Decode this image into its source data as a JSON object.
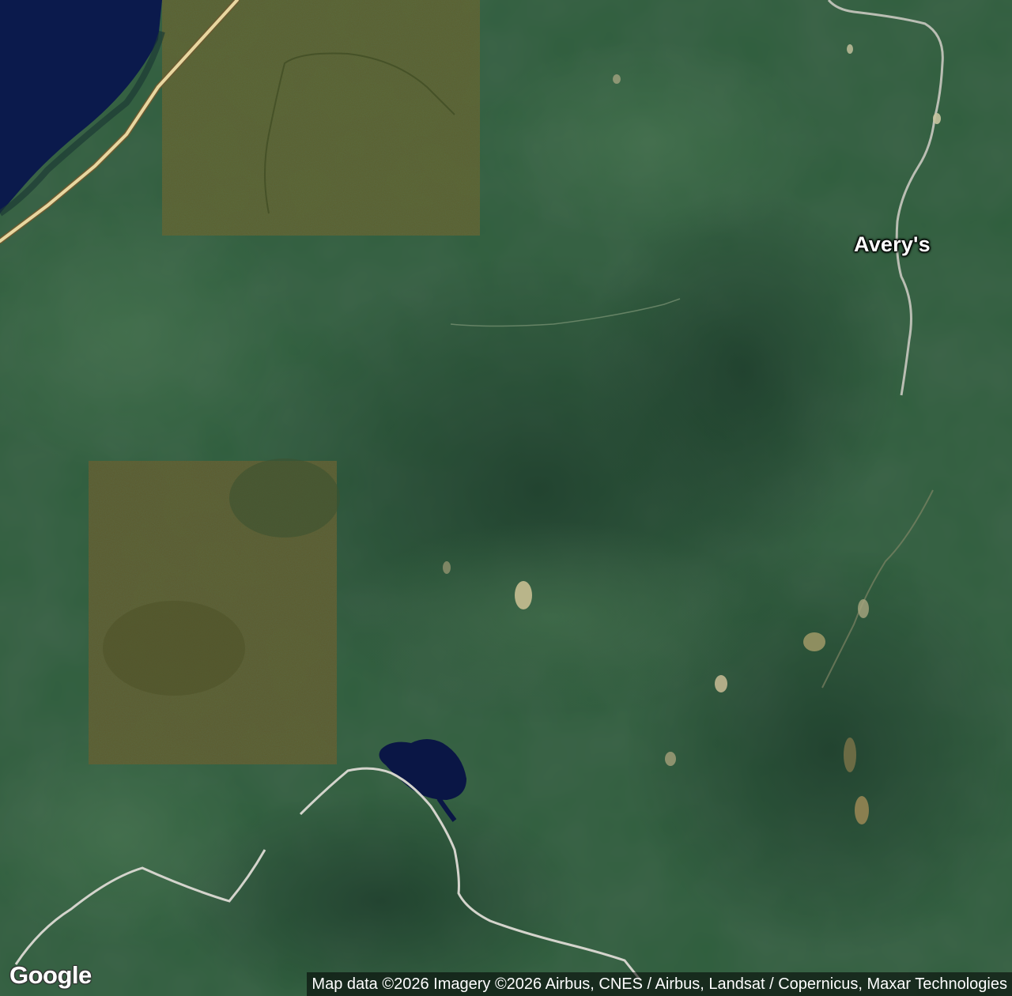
{
  "map": {
    "type": "satellite",
    "place_labels": [
      {
        "text": "Avery's"
      }
    ],
    "logo_text": "Google",
    "attribution": "Map data ©2026 Imagery ©2026 Airbus, CNES / Airbus, Landsat / Copernicus, Maxar Technologies",
    "colors": {
      "forest": "#2e5a3a",
      "forest_dark": "#213f2e",
      "clearcut_patch": "#5a5a2a",
      "water": "#0a1a4a",
      "highway": "#e8d7a0",
      "trail": "#c8c8c8"
    }
  }
}
